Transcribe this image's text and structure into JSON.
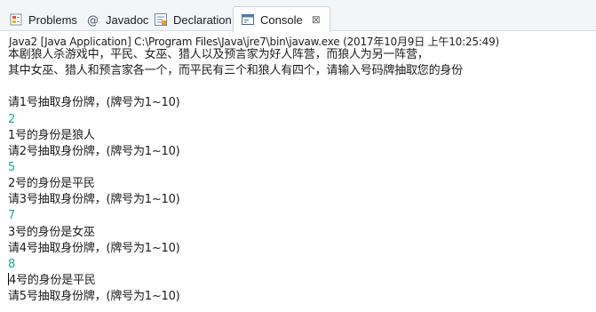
{
  "tabs": [
    {
      "label": "Problems",
      "icon": "problems-icon"
    },
    {
      "label": "Javadoc",
      "icon": "at-icon"
    },
    {
      "label": "Declaration",
      "icon": "declaration-icon"
    },
    {
      "label": "Console",
      "icon": "console-icon",
      "active": true
    }
  ],
  "console": {
    "close_symbol": "⊠",
    "launch_info": "Java2 [Java Application] C:\\Program Files\\Java\\jre7\\bin\\javaw.exe (2017年10月9日 上午10:25:49)",
    "lines": [
      {
        "text": "本剧狼人杀游戏中，平民、女巫、猎人以及预言家为好人阵营，而狼人为另一阵营，",
        "type": "output"
      },
      {
        "text": "其中女巫、猎人和预言家各一个，而平民有三个和狼人有四个，请输入号码牌抽取您的身份",
        "type": "output"
      },
      {
        "text": "",
        "type": "output"
      },
      {
        "text": "请1号抽取身份牌，(牌号为1~10)",
        "type": "output"
      },
      {
        "text": "2",
        "type": "input"
      },
      {
        "text": "1号的身份是狼人",
        "type": "output"
      },
      {
        "text": "请2号抽取身份牌，(牌号为1~10)",
        "type": "output"
      },
      {
        "text": "5",
        "type": "input"
      },
      {
        "text": "2号的身份是平民",
        "type": "output"
      },
      {
        "text": "请3号抽取身份牌，(牌号为1~10)",
        "type": "output"
      },
      {
        "text": "7",
        "type": "input"
      },
      {
        "text": "3号的身份是女巫",
        "type": "output"
      },
      {
        "text": "请4号抽取身份牌，(牌号为1~10)",
        "type": "output"
      },
      {
        "text": "8",
        "type": "input"
      },
      {
        "text": "4号的身份是平民",
        "type": "output"
      },
      {
        "text": "请5号抽取身份牌，(牌号为1~10)",
        "type": "output"
      }
    ]
  },
  "colors": {
    "input_text": "#1fa88a",
    "output_text": "#1c1c1c",
    "tabbar_bg": "#f3f6f9"
  }
}
